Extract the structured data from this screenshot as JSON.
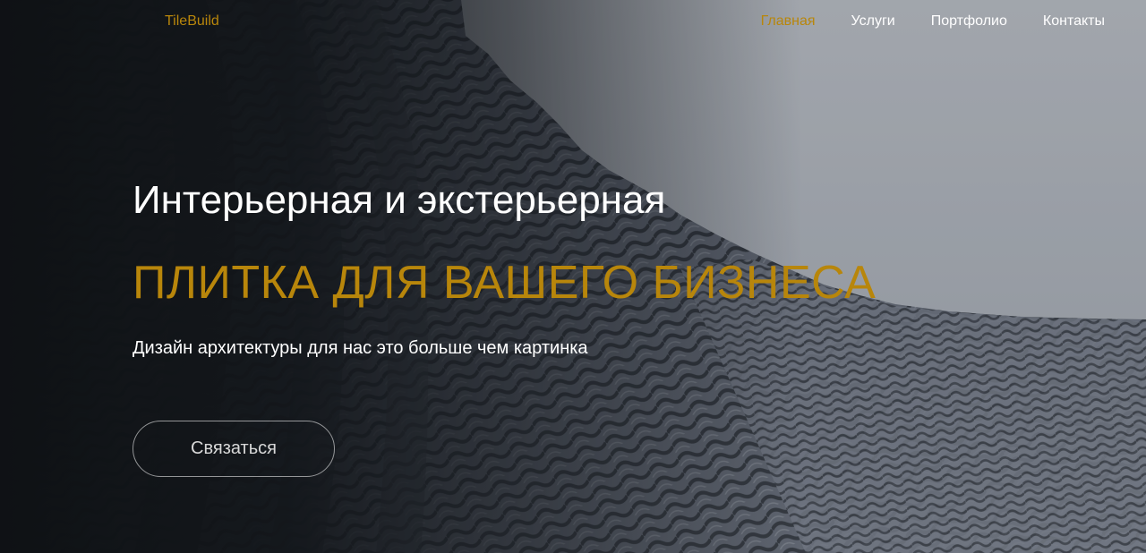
{
  "colors": {
    "accent": "#b8860b",
    "text": "#ffffff",
    "sky": "#b9bec8",
    "dark": "#15181d"
  },
  "header": {
    "logo": "TileBuild",
    "nav": [
      {
        "label": "Главная",
        "active": true
      },
      {
        "label": "Услуги",
        "active": false
      },
      {
        "label": "Портфолио",
        "active": false
      },
      {
        "label": "Контакты",
        "active": false
      }
    ]
  },
  "hero": {
    "title": "Интерьерная и экстерьерная",
    "headline": "ПЛИТКА ДЛЯ ВАШЕГО БИЗНЕСА",
    "subtitle": "Дизайн архитектуры для нас это больше чем картинка",
    "cta_label": "Связаться",
    "background_image": "architectural-facade-photo"
  }
}
